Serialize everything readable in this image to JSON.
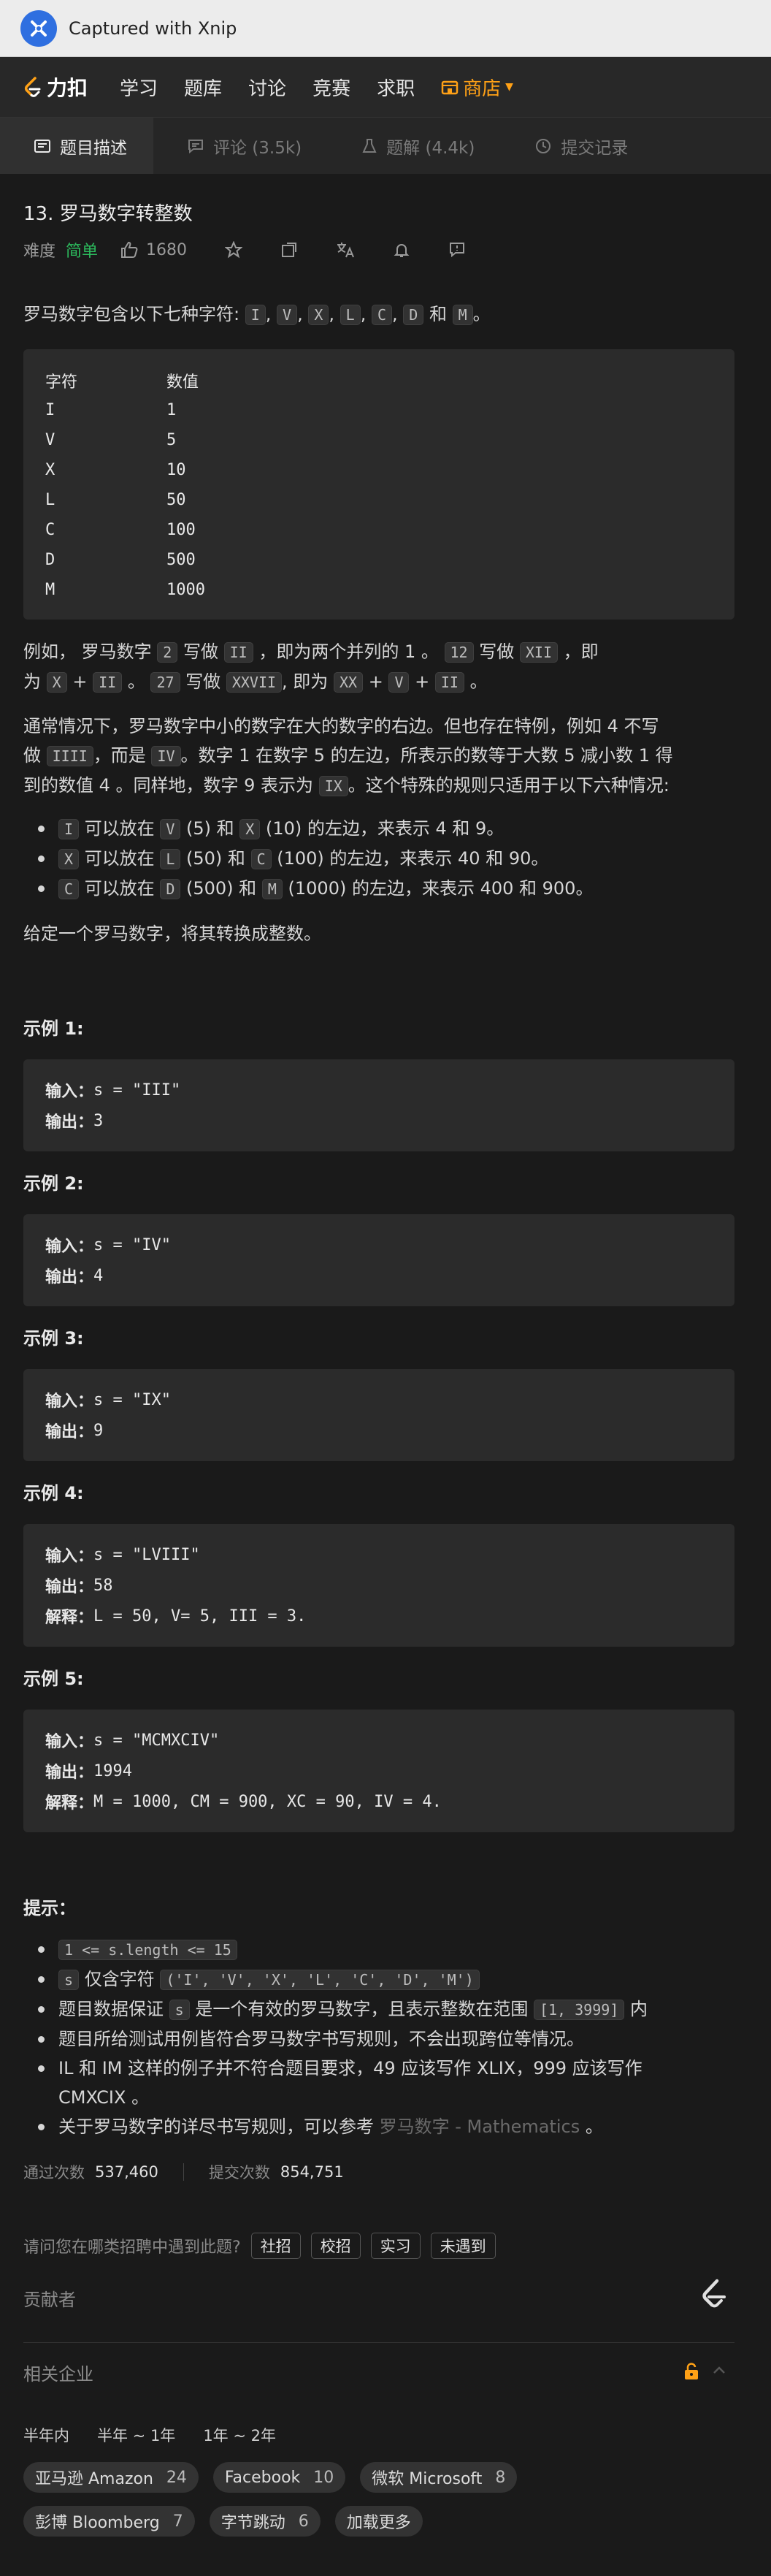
{
  "capture": {
    "title": "Captured with Xnip"
  },
  "nav": {
    "brand": "力扣",
    "links": [
      "学习",
      "题库",
      "讨论",
      "竞赛",
      "求职"
    ],
    "store": "商店",
    "colors": {
      "accent": "#ffa116"
    }
  },
  "tabs": [
    {
      "label": "题目描述",
      "icon": "description-icon",
      "active": true
    },
    {
      "label": "评论 (3.5k)",
      "icon": "comment-icon"
    },
    {
      "label": "题解 (4.4k)",
      "icon": "flask-icon"
    },
    {
      "label": "提交记录",
      "icon": "history-icon"
    }
  ],
  "problem": {
    "title": "13. 罗马数字转整数",
    "difficulty_label": "难度",
    "difficulty": "简单",
    "likes": "1680",
    "intro": {
      "text": "罗马数字包含以下七种字符:",
      "chars": [
        "I",
        "V",
        "X",
        "L",
        "C",
        "D",
        "M"
      ],
      "and": "和",
      "end": "。"
    },
    "symbol_table": {
      "headers": [
        "字符",
        "数值"
      ],
      "rows": [
        [
          "I",
          "1"
        ],
        [
          "V",
          "5"
        ],
        [
          "X",
          "10"
        ],
        [
          "L",
          "50"
        ],
        [
          "C",
          "100"
        ],
        [
          "D",
          "500"
        ],
        [
          "M",
          "1000"
        ]
      ]
    },
    "para1": {
      "t1": "例如， 罗马数字",
      "c1": "2",
      "t2": "写做",
      "c2": "II",
      "t3": "，即为两个并列的 1 。",
      "c3": "12",
      "t4": "写做",
      "c4": "XII",
      "t5": "，即",
      "t6": "为",
      "c5": "X",
      "t7": "+",
      "c6": "II",
      "t8": "。",
      "c7": "27",
      "t9": "写做",
      "c8": "XXVII",
      "t10": ", 即为",
      "c9": "XX",
      "t11": "+",
      "c10": "V",
      "t12": "+",
      "c11": "II",
      "t13": "。"
    },
    "para2": {
      "line1": "通常情况下，罗马数字中小的数字在大的数字的右边。但也存在特例，例如 4 不写",
      "t1": "做",
      "c1": "IIII",
      "t2": "，而是",
      "c2": "IV",
      "t3": "。数字 1 在数字 5 的左边，所表示的数等于大数 5 减小数 1 得",
      "t4": "到的数值 4 。同样地，数字 9 表示为",
      "c3": "IX",
      "t5": "。这个特殊的规则只适用于以下六种情况:"
    },
    "rules": [
      {
        "c1": "I",
        "t1": "可以放在",
        "c2": "V",
        "t2": "(5) 和",
        "c3": "X",
        "t3": "(10) 的左边，来表示 4 和 9。"
      },
      {
        "c1": "X",
        "t1": "可以放在",
        "c2": "L",
        "t2": "(50) 和",
        "c3": "C",
        "t3": "(100) 的左边，来表示 40 和 90。"
      },
      {
        "c1": "C",
        "t1": "可以放在",
        "c2": "D",
        "t2": "(500) 和",
        "c3": "M",
        "t3": "(1000) 的左边，来表示 400 和 900。"
      }
    ],
    "task": "给定一个罗马数字，将其转换成整数。",
    "examples": [
      {
        "title": "示例 1:",
        "input": "s = \"III\"",
        "output": "3"
      },
      {
        "title": "示例 2:",
        "input": "s = \"IV\"",
        "output": "4"
      },
      {
        "title": "示例 3:",
        "input": "s = \"IX\"",
        "output": "9"
      },
      {
        "title": "示例 4:",
        "input": "s = \"LVIII\"",
        "output": "58",
        "explain": "L = 50, V= 5, III = 3."
      },
      {
        "title": "示例 5:",
        "input": "s = \"MCMXCIV\"",
        "output": "1994",
        "explain": "M = 1000, CM = 900, XC = 90, IV = 4."
      }
    ],
    "labels": {
      "input": "输入：",
      "output": "输出：",
      "explain": "解释："
    },
    "hints_title": "提示：",
    "hints": {
      "h1": "1 <= s.length <= 15",
      "h2_code1": "s",
      "h2_text": "仅含字符",
      "h2_code2": "('I', 'V', 'X', 'L', 'C', 'D', 'M')",
      "h3_t1": "题目数据保证",
      "h3_code1": "s",
      "h3_t2": "是一个有效的罗马数字，且表示整数在范围",
      "h3_code2": "[1, 3999]",
      "h3_t3": "内",
      "h4": "题目所给测试用例皆符合罗马数字书写规则，不会出现跨位等情况。",
      "h5_line1": "IL 和 IM 这样的例子并不符合题目要求，49 应该写作 XLIX，999 应该写作",
      "h5_line2": "CMXCIX 。",
      "h6_text": "关于罗马数字的详尽书写规则，可以参考",
      "h6_link": "罗马数字 - Mathematics",
      "h6_end": "。"
    }
  },
  "stats": {
    "accepted_label": "通过次数",
    "accepted": "537,460",
    "submitted_label": "提交次数",
    "submitted": "854,751"
  },
  "ask": {
    "question": "请问您在哪类招聘中遇到此题?",
    "options": [
      "社招",
      "校招",
      "实习",
      "未遇到"
    ]
  },
  "contributors_title": "贡献者",
  "companies": {
    "title": "相关企业",
    "periods": [
      "半年内",
      "半年 ~ 1年",
      "1年 ~ 2年"
    ],
    "list": [
      {
        "name": "亚马逊 Amazon",
        "count": "24"
      },
      {
        "name": "Facebook",
        "count": "10"
      },
      {
        "name": "微软 Microsoft",
        "count": "8"
      },
      {
        "name": "彭博 Bloomberg",
        "count": "7"
      },
      {
        "name": "字节跳动",
        "count": "6"
      }
    ],
    "more": "加载更多"
  }
}
